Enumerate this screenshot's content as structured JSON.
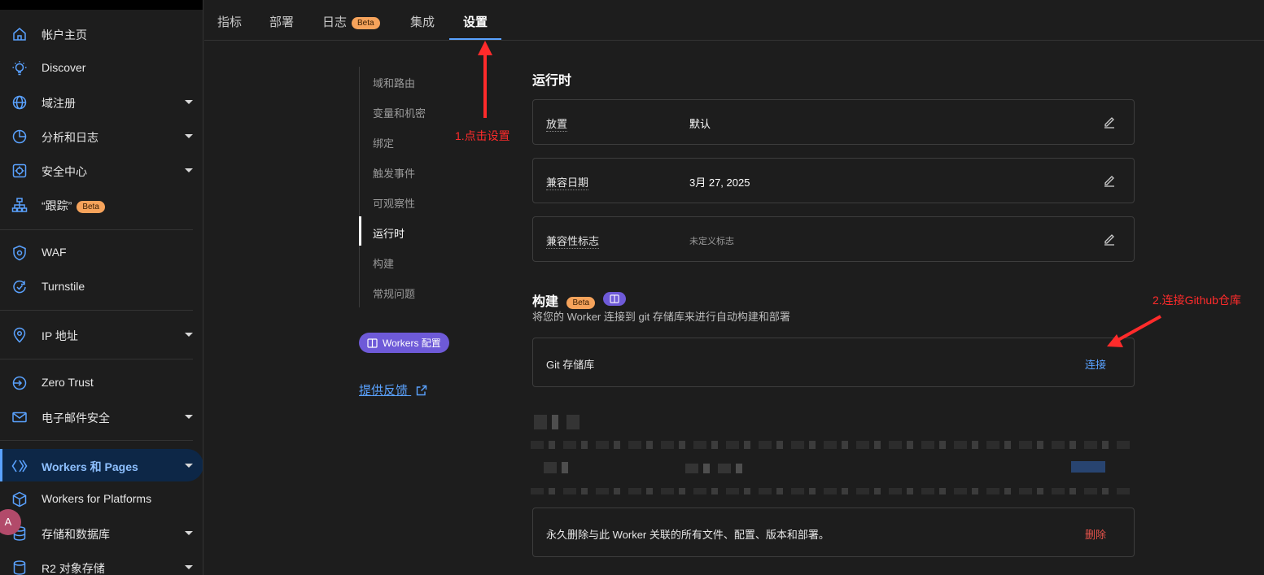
{
  "sidebar": {
    "items": [
      {
        "label": "帐户主页",
        "icon": "home-icon"
      },
      {
        "label": "Discover",
        "icon": "lightbulb-icon"
      },
      {
        "label": "域注册",
        "icon": "globe-icon"
      },
      {
        "label": "分析和日志",
        "icon": "pie-chart-icon"
      },
      {
        "label": "安全中心",
        "icon": "security-center-icon"
      },
      {
        "label": "“跟踪”",
        "icon": "sitemap-icon",
        "badge": "Beta"
      },
      {
        "label": "WAF",
        "icon": "shield-gear-icon"
      },
      {
        "label": "Turnstile",
        "icon": "turnstile-icon"
      },
      {
        "label": "IP 地址",
        "icon": "location-pin-icon"
      },
      {
        "label": "Zero Trust",
        "icon": "zero-trust-icon"
      },
      {
        "label": "电子邮件安全",
        "icon": "envelope-icon"
      },
      {
        "label": "Workers 和 Pages",
        "icon": "workers-icon"
      },
      {
        "label": "Workers for Platforms",
        "icon": "cube-icon"
      },
      {
        "label": "存储和数据库",
        "icon": "database-icon"
      },
      {
        "label": "R2 对象存储",
        "icon": "r2-storage-icon"
      }
    ]
  },
  "tabs": [
    {
      "label": "指标"
    },
    {
      "label": "部署"
    },
    {
      "label": "日志",
      "badge": "Beta"
    },
    {
      "label": "集成"
    },
    {
      "label": "设置"
    }
  ],
  "subnav": {
    "items": [
      "域和路由",
      "变量和机密",
      "绑定",
      "触发事件",
      "可观察性",
      "运行时",
      "构建",
      "常规问题"
    ],
    "workers_config": "Workers 配置",
    "feedback": "提供反馈"
  },
  "runtime": {
    "title": "运行时",
    "rows": [
      {
        "key": "放置",
        "value": "默认"
      },
      {
        "key": "兼容日期",
        "value": "3月 27, 2025"
      },
      {
        "key": "兼容性标志",
        "value": "未定义标志"
      }
    ]
  },
  "build": {
    "title": "构建",
    "badge": "Beta",
    "description": "将您的 Worker 连接到 git 存储库来进行自动构建和部署",
    "git_label": "Git 存储库",
    "connect": "连接"
  },
  "delete_card": {
    "text": "永久删除与此 Worker 关联的所有文件、配置、版本和部署。",
    "action": "删除"
  },
  "annotations": {
    "step1": "1.点击设置",
    "step2": "2.连接Github仓库"
  },
  "translate_badge": "A",
  "colors": {
    "accent": "#5aa2ff",
    "beta": "#f6a35b",
    "purple": "#6e5ad8",
    "danger": "#e5534b",
    "annotation": "#ff2b2b"
  }
}
